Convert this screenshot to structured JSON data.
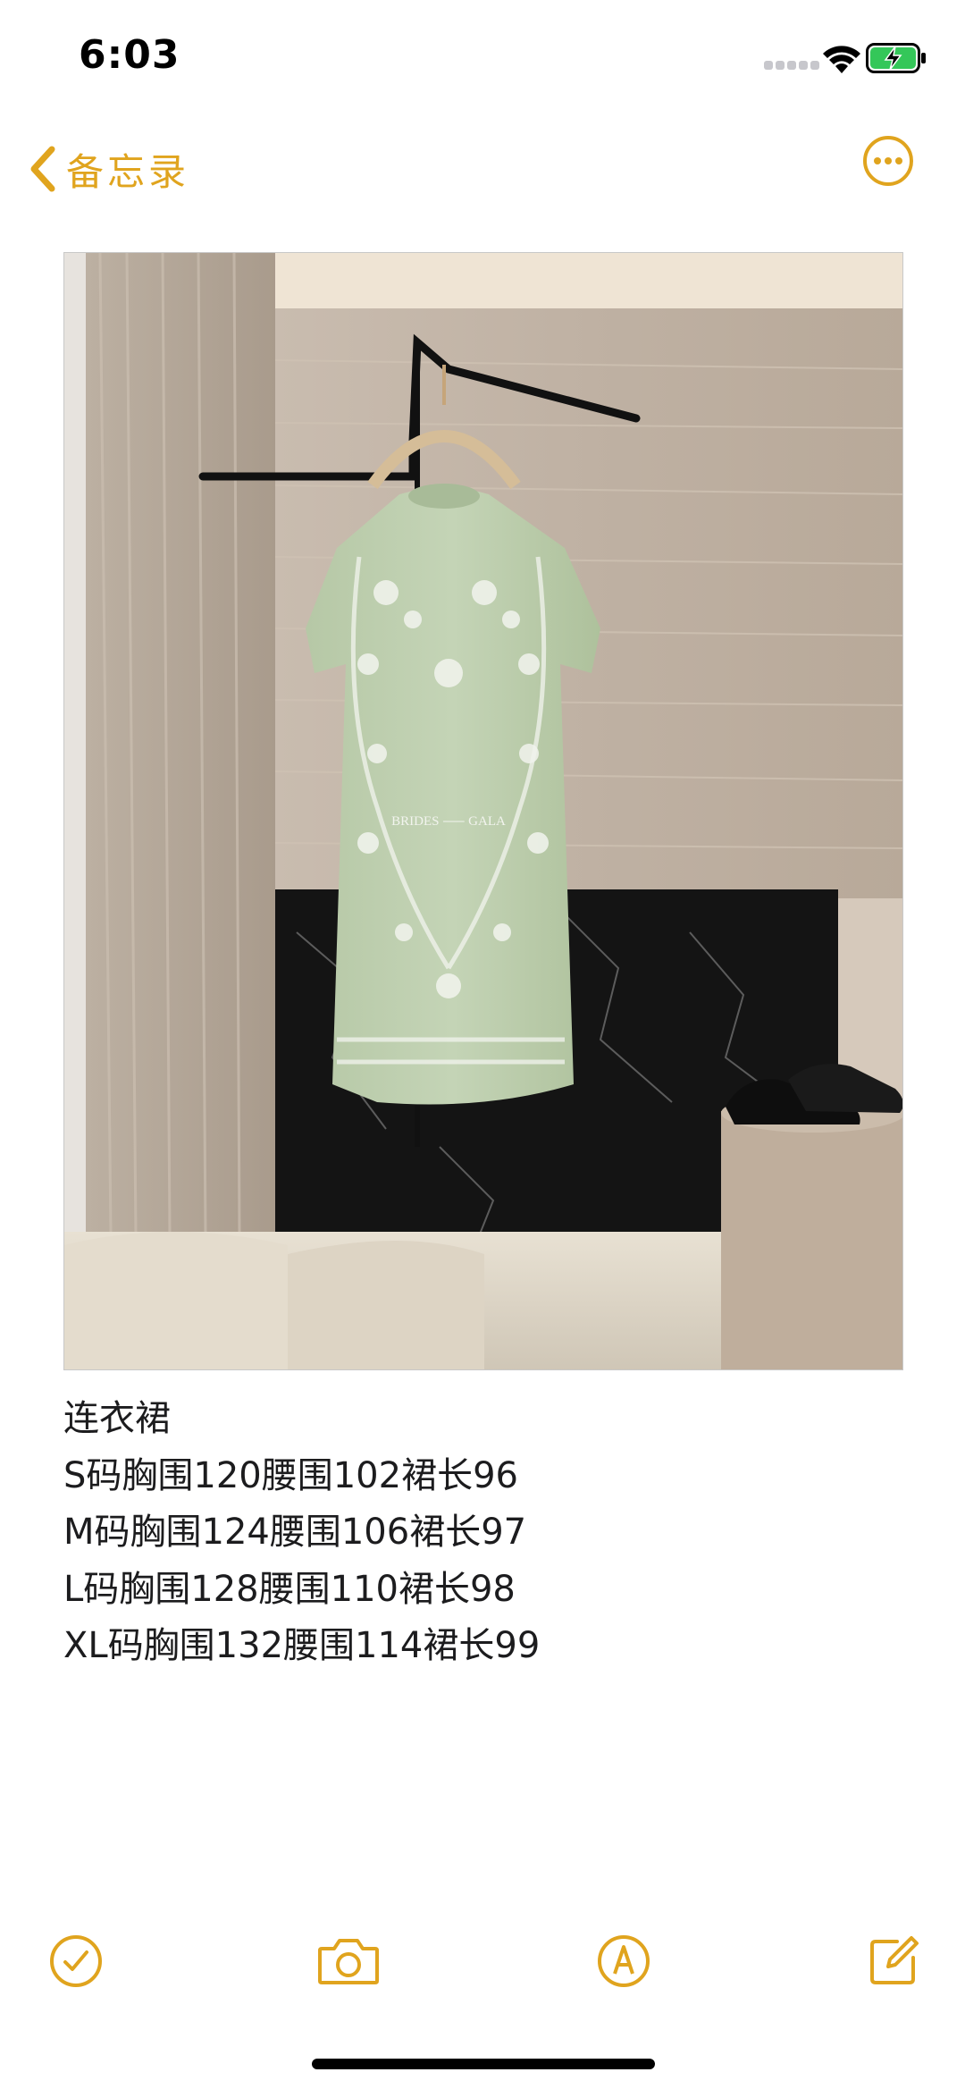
{
  "status": {
    "time": "6:03",
    "signal_icon": "cellular-signal-icon",
    "wifi_icon": "wifi-icon",
    "battery_icon": "battery-charging-icon",
    "battery_color": "#34c759"
  },
  "nav": {
    "back_label": "备忘录",
    "back_icon": "chevron-left-icon",
    "more_icon": "ellipsis-circle-icon"
  },
  "accent_color": "#e0a41e",
  "note": {
    "image_label": "BRIDES ⸺ GALA",
    "lines": [
      "连衣裙",
      "S码胸围120腰围102裙长96",
      "M码胸围124腰围106裙长97",
      "L码胸围128腰围110裙长98",
      "XL码胸围132腰围114裙长99"
    ]
  },
  "toolbar": {
    "checklist_icon": "checklist-icon",
    "camera_icon": "camera-icon",
    "markup_icon": "markup-pen-icon",
    "compose_icon": "compose-icon"
  }
}
